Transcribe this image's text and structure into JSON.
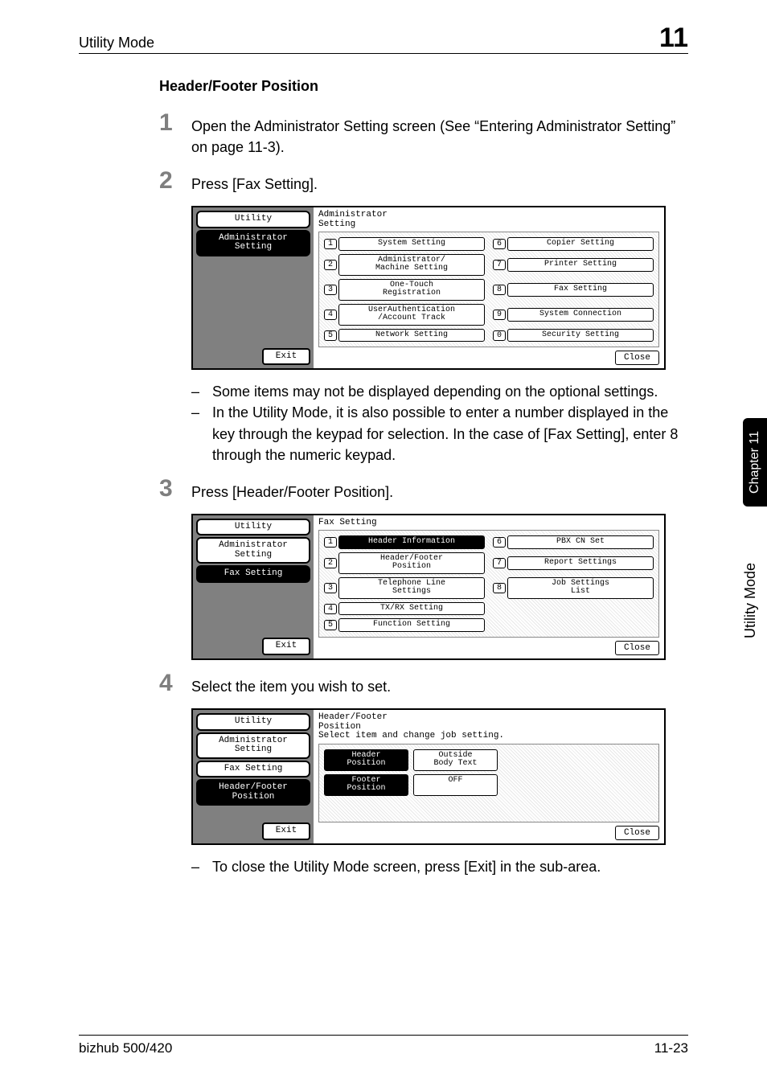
{
  "header": {
    "left": "Utility Mode",
    "right": "11"
  },
  "section_title": "Header/Footer Position",
  "steps": {
    "s1": {
      "num": "1",
      "text": "Open the Administrator Setting screen (See “Entering Administrator Setting” on page 11-3)."
    },
    "s2": {
      "num": "2",
      "text": "Press [Fax Setting]."
    },
    "s3": {
      "num": "3",
      "text": "Press [Header/Footer Position]."
    },
    "s4": {
      "num": "4",
      "text": "Select the item you wish to set."
    }
  },
  "notes": {
    "n1": "Some items may not be displayed depending on the optional settings.",
    "n2": "In the Utility Mode, it is also possible to enter a number displayed in the key through the keypad for selection. In the case of [Fax Setting], enter 8 through the numeric keypad.",
    "n3": "To close the Utility Mode screen, press [Exit] in the sub-area."
  },
  "ss1": {
    "left": {
      "tab1": "Utility",
      "tab2": "Administrator\nSetting",
      "exit": "Exit"
    },
    "title": "Administrator\nSetting",
    "items": [
      {
        "n": "1",
        "l": "System Setting"
      },
      {
        "n": "6",
        "l": "Copier Setting"
      },
      {
        "n": "2",
        "l": "Administrator/\nMachine Setting"
      },
      {
        "n": "7",
        "l": "Printer Setting"
      },
      {
        "n": "3",
        "l": "One-Touch\nRegistration"
      },
      {
        "n": "8",
        "l": "Fax Setting"
      },
      {
        "n": "4",
        "l": "UserAuthentication\n/Account Track"
      },
      {
        "n": "9",
        "l": "System Connection"
      },
      {
        "n": "5",
        "l": "Network Setting"
      },
      {
        "n": "0",
        "l": "Security Setting"
      }
    ],
    "close": "Close"
  },
  "ss2": {
    "left": {
      "tab1": "Utility",
      "tab2": "Administrator\nSetting",
      "tab3": "Fax Setting",
      "exit": "Exit"
    },
    "title": "Fax Setting",
    "items": [
      {
        "n": "1",
        "l": "Header Information",
        "sel": true
      },
      {
        "n": "6",
        "l": "PBX CN Set"
      },
      {
        "n": "2",
        "l": "Header/Footer\nPosition"
      },
      {
        "n": "7",
        "l": "Report Settings"
      },
      {
        "n": "3",
        "l": "Telephone Line\nSettings"
      },
      {
        "n": "8",
        "l": "Job Settings\nList"
      },
      {
        "n": "4",
        "l": "TX/RX Setting"
      },
      {
        "n": "",
        "l": ""
      },
      {
        "n": "5",
        "l": "Function Setting"
      },
      {
        "n": "",
        "l": ""
      }
    ],
    "close": "Close"
  },
  "ss3": {
    "left": {
      "tab1": "Utility",
      "tab2": "Administrator\nSetting",
      "tab3": "Fax Setting",
      "tab4": "Header/Footer\nPosition",
      "exit": "Exit"
    },
    "title": "Header/Footer\nPosition",
    "subtitle": "Select item and change job setting.",
    "rows": [
      {
        "a": "Header\nPosition",
        "b": "Outside\nBody Text"
      },
      {
        "a": "Footer\nPosition",
        "b": "OFF"
      }
    ],
    "close": "Close"
  },
  "side": {
    "tab": "Chapter 11",
    "label": "Utility Mode"
  },
  "footer": {
    "left": "bizhub 500/420",
    "right": "11-23"
  }
}
